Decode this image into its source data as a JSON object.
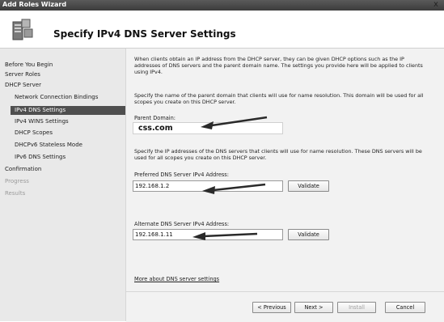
{
  "window": {
    "title": "Add Roles Wizard",
    "close_glyph": "x"
  },
  "header": {
    "title": "Specify IPv4 DNS Server Settings",
    "icon": "server-roles-icon"
  },
  "nav": {
    "items": [
      {
        "label": "Before You Begin",
        "level": "top",
        "state": "normal"
      },
      {
        "label": "Server Roles",
        "level": "top",
        "state": "normal"
      },
      {
        "label": "DHCP Server",
        "level": "top",
        "state": "normal"
      },
      {
        "label": "Network Connection Bindings",
        "level": "sub",
        "state": "normal"
      },
      {
        "label": "IPv4 DNS Settings",
        "level": "sub",
        "state": "selected"
      },
      {
        "label": "IPv4 WINS Settings",
        "level": "sub",
        "state": "normal"
      },
      {
        "label": "DHCP Scopes",
        "level": "sub",
        "state": "normal"
      },
      {
        "label": "DHCPv6 Stateless Mode",
        "level": "sub",
        "state": "normal"
      },
      {
        "label": "IPv6 DNS Settings",
        "level": "sub",
        "state": "normal"
      },
      {
        "label": "Confirmation",
        "level": "top",
        "state": "normal"
      },
      {
        "label": "Progress",
        "level": "top",
        "state": "disabled"
      },
      {
        "label": "Results",
        "level": "top",
        "state": "disabled"
      }
    ]
  },
  "main": {
    "intro_lines": [
      "When clients obtain an IP address from the DHCP server, they can be given DHCP options such as the IP",
      "addresses of DNS servers and the parent domain name. The settings you provide here will be applied to clients",
      "using IPv4."
    ],
    "domain_lines": [
      "Specify the name of the parent domain that clients will use for name resolution. This domain will be used for all",
      "scopes you create on this DHCP server."
    ],
    "parent_domain_label": "Parent Domain:",
    "parent_domain_value": "css.com",
    "dns_lines": [
      "Specify the IP addresses of the DNS servers that clients will use for name resolution. These DNS servers will be",
      "used for all scopes you create on this DHCP server."
    ],
    "preferred_label": "Preferred DNS Server IPv4 Address:",
    "preferred_value": "192.168.1.2",
    "alternate_label": "Alternate DNS Server IPv4 Address:",
    "alternate_value": "192.168.1.11",
    "validate_label": "Validate",
    "more_link": "More about DNS server settings"
  },
  "footer": {
    "previous": "< Previous",
    "next": "Next >",
    "install": "Install",
    "cancel": "Cancel"
  }
}
